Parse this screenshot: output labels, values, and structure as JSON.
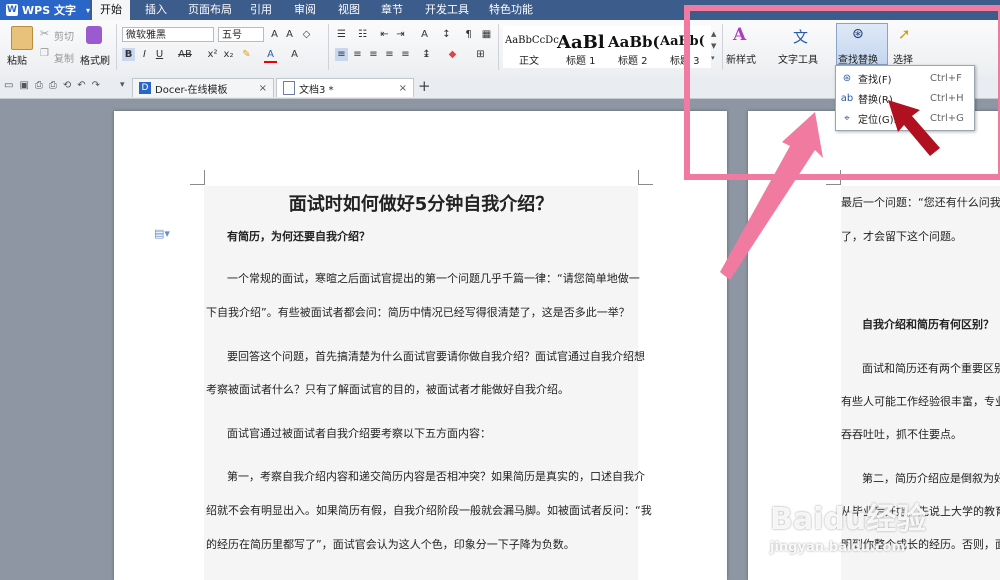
{
  "app": {
    "name": "WPS 文字"
  },
  "menu_tabs": [
    "开始",
    "插入",
    "页面布局",
    "引用",
    "审阅",
    "视图",
    "章节",
    "开发工具",
    "特色功能"
  ],
  "ribbon": {
    "paste": "粘贴",
    "cut": "剪切",
    "copy": "复制",
    "format_painter": "格式刷",
    "font_name": "微软雅黑",
    "font_size": "五号",
    "styles": [
      {
        "sample": "AaBbCcDc",
        "name": "正文"
      },
      {
        "sample": "AaBl",
        "name": "标题 1"
      },
      {
        "sample": "AaBb(",
        "name": "标题 2"
      },
      {
        "sample": "AaBb(",
        "name": "标题 3"
      }
    ],
    "new_style": "新样式",
    "text_tools": "文字工具",
    "find_replace": "查找替换",
    "select": "选择"
  },
  "tabs": [
    {
      "label": "Docer-在线模板"
    },
    {
      "label": "文档3 *"
    }
  ],
  "dropdown": {
    "items": [
      {
        "label": "查找(F)",
        "shortcut": "Ctrl+F"
      },
      {
        "label": "替换(R)",
        "shortcut": "Ctrl+H"
      },
      {
        "label": "定位(G)...",
        "shortcut": "Ctrl+G"
      }
    ]
  },
  "doc": {
    "title": "面试时如何做好5分钟自我介绍？",
    "lines": [
      "有简历，为何还要自我介绍？",
      "一个常规的面试，寒暄之后面试官提出的第一个问题几乎千篇一律：“请您简单地做一",
      "下自我介绍”。有些被面试者都会问：简历中情况已经写得很清楚了，这是否多此一举？",
      "要回答这个问题，首先搞清楚为什么面试官要请你做自我介绍？面试官通过自我介绍想",
      "考察被面试者什么？只有了解面试官的目的，被面试者才能做好自我介绍。",
      "面试官通过被面试者自我介绍要考察以下五方面内容：",
      "第一，考察自我介绍内容和递交简历内容是否相冲突？如果简历是真实的，口述自我介",
      "绍就不会有明显出入。如果简历有假，自我介绍阶段一般就会漏马脚。如被面试者反问：“我",
      "的经历在简历里都写了”，面试官会认为这人个色，印象分一下子降为负数。"
    ],
    "page2_lines": [
      "最后一个问题：“您还有什么问我",
      "了，才会留下这个问题。",
      "自我介绍和简历有何区别？",
      "面试和简历还有两个重要区别",
      "有些人可能工作经验很丰富，专业",
      "吞吞吐吐，抓不住要点。",
      "第二，简历介绍应是倒叙为好",
      "从毕业后开始，先说上大学的教育",
      "明到你整个成长的经历。否则，面"
    ]
  },
  "watermark": {
    "logo": "Baidu经验",
    "url": "jingyan.baidu.com"
  }
}
